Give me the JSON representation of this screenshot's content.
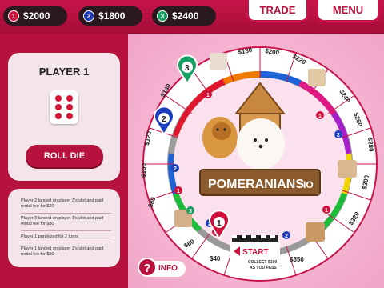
{
  "players": [
    {
      "badge": "1",
      "money": "$2000",
      "color": "#d0103a"
    },
    {
      "badge": "2",
      "money": "$1800",
      "color": "#1d3fbf"
    },
    {
      "badge": "3",
      "money": "$2400",
      "color": "#15a062"
    }
  ],
  "topbar": {
    "trade_label": "TRADE",
    "menu_label": "MENU"
  },
  "turn_panel": {
    "title": "PLAYER 1",
    "die_value": 6,
    "roll_label": "ROLL DIE"
  },
  "log": [
    "Player 2 landed on player 3's slot and paid rental fee for $20",
    "Player 3 landed on player 1's slot and paid rental fee for $80",
    "Player 1 paralyzed for 2 turns",
    "Player 1 landed on player 2's slot and paid rental fee for $50"
  ],
  "info_label": "INFO",
  "board": {
    "title": "POMERANIANS",
    "title_suffix": "IO",
    "start_label": "START",
    "start_sub1": "COLLECT $100",
    "start_sub2": "AS YOU PASS",
    "prices_top": [
      "$180",
      "$200",
      "$220"
    ],
    "prices_right": [
      "$240",
      "$260",
      "$280",
      "$300",
      "$320"
    ],
    "prices_bottom": [
      "$350"
    ],
    "prices_left": [
      "$140",
      "$120",
      "$100",
      "$80",
      "$60",
      "$40"
    ],
    "owner_badges": [
      "1",
      "2",
      "1",
      "2",
      "1",
      "2",
      "1",
      "3",
      "2",
      "1"
    ]
  },
  "tokens": [
    {
      "number": "3",
      "color": "#15a062"
    },
    {
      "number": "2",
      "color": "#1d3fbf"
    },
    {
      "number": "1",
      "color": "#d0103a"
    }
  ]
}
